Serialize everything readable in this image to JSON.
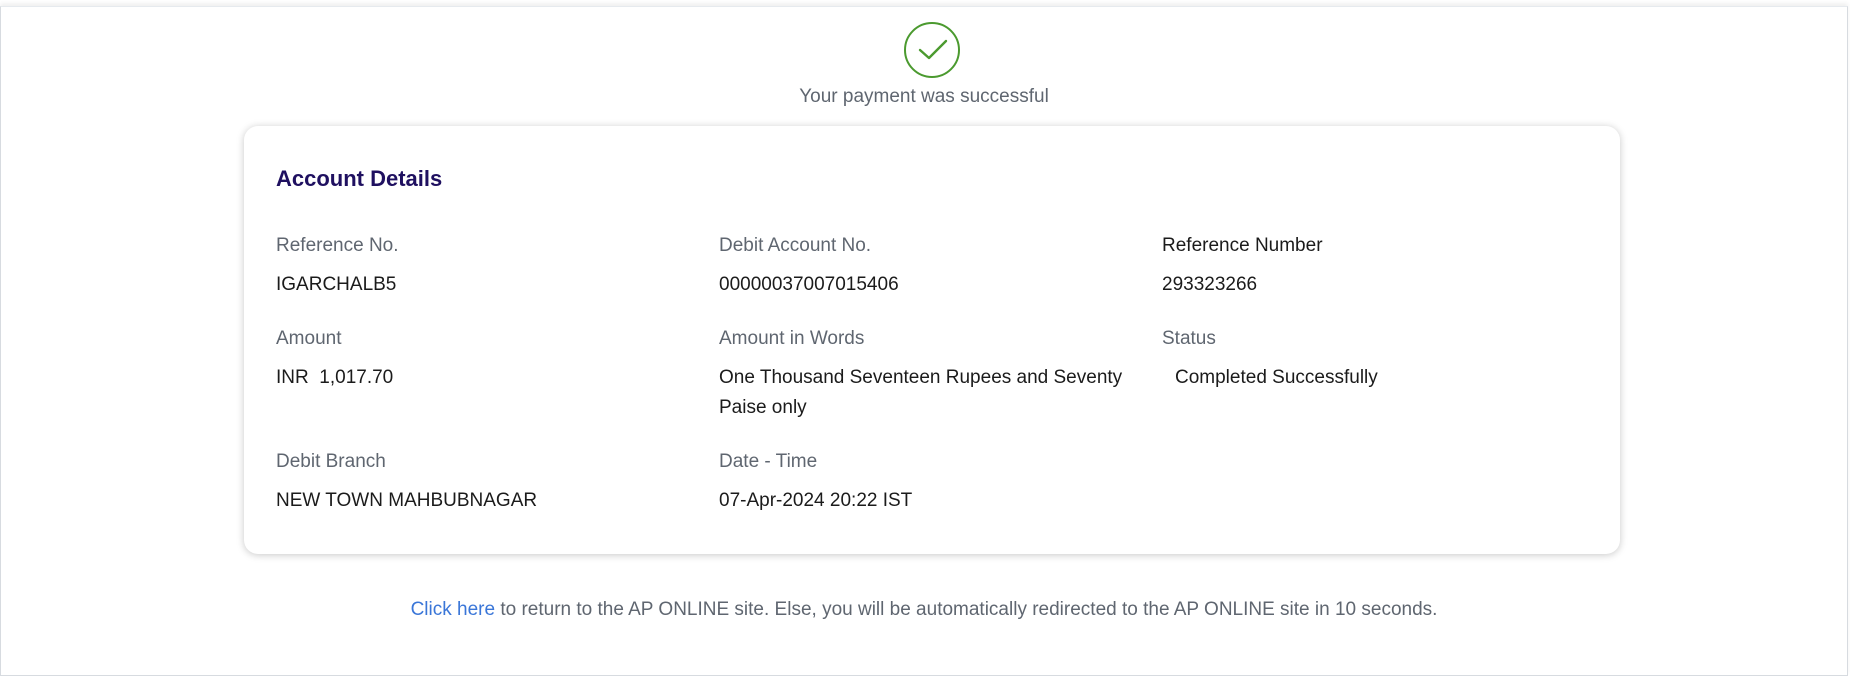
{
  "status": {
    "icon": "check-circle-icon",
    "message": "Your payment was successful",
    "color": "#4b9a2f"
  },
  "card": {
    "title": "Account Details",
    "fields": {
      "reference_no": {
        "label": "Reference No.",
        "value": "IGARCHALB5"
      },
      "debit_account_no": {
        "label": "Debit Account No.",
        "value": "00000037007015406"
      },
      "reference_number": {
        "label": "Reference Number",
        "value": "293323266"
      },
      "amount": {
        "label": "Amount",
        "value": "INR  1,017.70"
      },
      "amount_in_words": {
        "label": "Amount in Words",
        "value": "One Thousand Seventeen Rupees and Seventy Paise only"
      },
      "status": {
        "label": "Status",
        "value": "Completed Successfully"
      },
      "debit_branch": {
        "label": "Debit Branch",
        "value": "NEW TOWN MAHBUBNAGAR"
      },
      "date_time": {
        "label": "Date - Time",
        "value": "07-Apr-2024 20:22 IST"
      }
    }
  },
  "footer": {
    "link_text": "Click here",
    "text": " to return to the AP ONLINE site. Else, you will be automatically redirected to the AP ONLINE site in 10 seconds."
  },
  "colors": {
    "title": "#1f1060",
    "link": "#3a76d8",
    "success": "#4b9a2f"
  }
}
